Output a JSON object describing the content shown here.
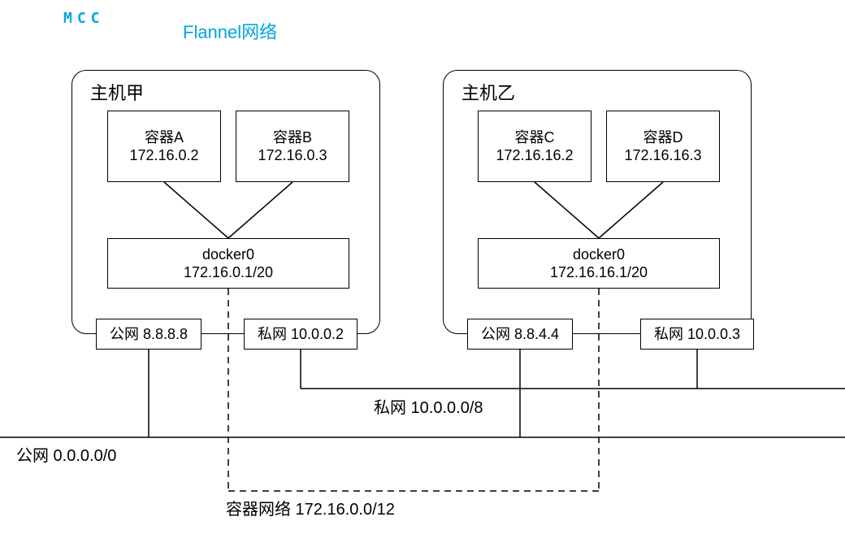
{
  "header": {
    "logo": "MCC",
    "title": "Flannel网络"
  },
  "hosts": [
    {
      "label": "主机甲",
      "containers": [
        {
          "name": "容器A",
          "ip": "172.16.0.2"
        },
        {
          "name": "容器B",
          "ip": "172.16.0.3"
        }
      ],
      "bridge": {
        "name": "docker0",
        "cidr": "172.16.0.1/20"
      },
      "public_if": "公网 8.8.8.8",
      "private_if": "私网 10.0.0.2"
    },
    {
      "label": "主机乙",
      "containers": [
        {
          "name": "容器C",
          "ip": "172.16.16.2"
        },
        {
          "name": "容器D",
          "ip": "172.16.16.3"
        }
      ],
      "bridge": {
        "name": "docker0",
        "cidr": "172.16.16.1/20"
      },
      "public_if": "公网 8.8.4.4",
      "private_if": "私网 10.0.0.3"
    }
  ],
  "networks": {
    "private": "私网 10.0.0.0/8",
    "public": "公网 0.0.0.0/0",
    "container": "容器网络 172.16.0.0/12"
  }
}
